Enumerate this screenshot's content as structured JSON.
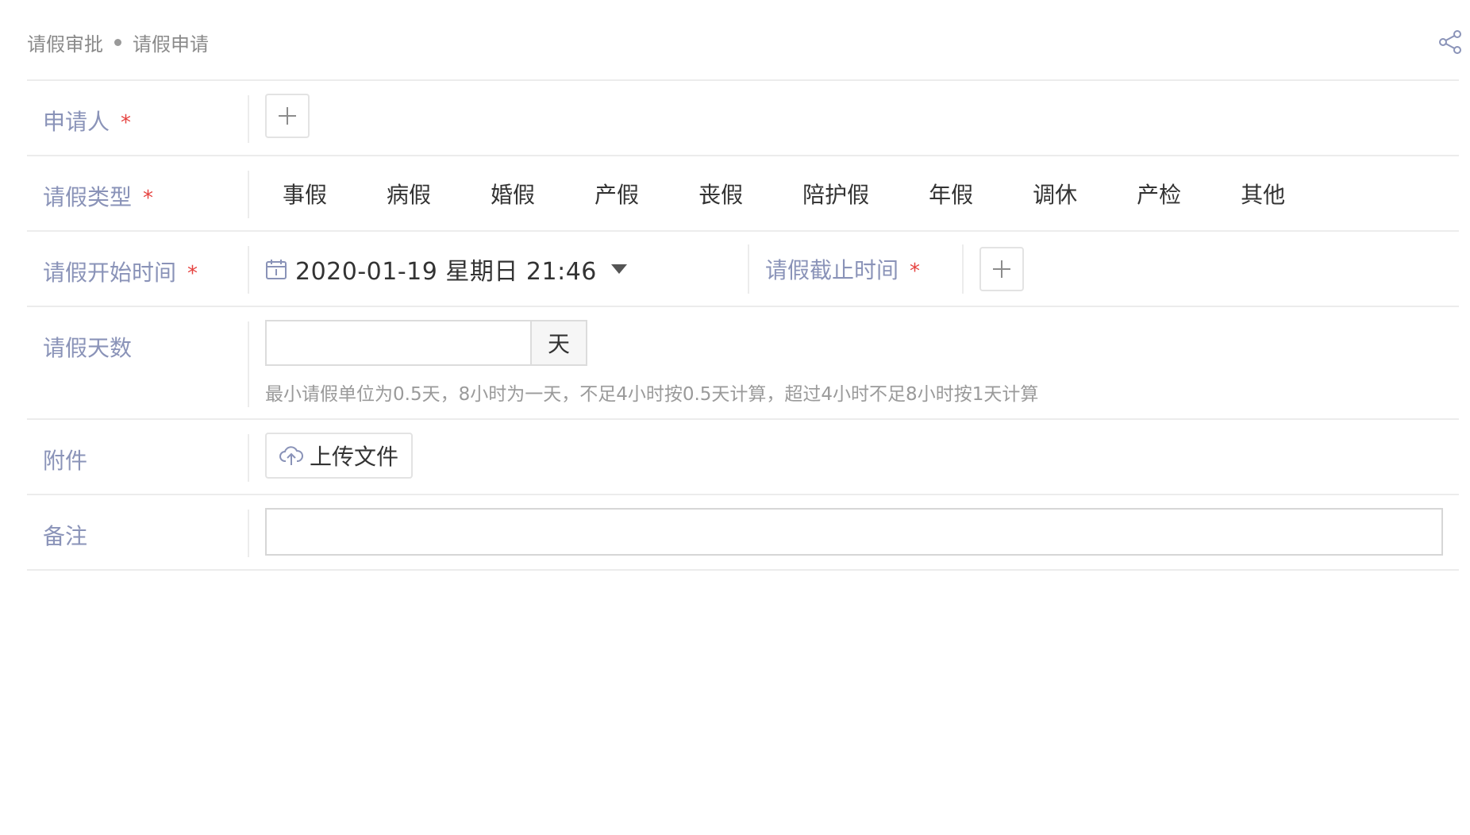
{
  "breadcrumb": {
    "parent": "请假审批",
    "current": "请假申请"
  },
  "icons": {
    "share": "share-icon",
    "add": "plus-icon",
    "calendar": "calendar-icon",
    "upload": "cloud-upload-icon",
    "dropdown": "caret-down-icon"
  },
  "form": {
    "applicant": {
      "label": "申请人",
      "required_mark": "*"
    },
    "leave_type": {
      "label": "请假类型",
      "required_mark": "*",
      "options": [
        "事假",
        "病假",
        "婚假",
        "产假",
        "丧假",
        "陪护假",
        "年假",
        "调休",
        "产检",
        "其他"
      ]
    },
    "start_time": {
      "label": "请假开始时间",
      "required_mark": "*",
      "value": "2020-01-19 星期日 21:46"
    },
    "end_time": {
      "label": "请假截止时间",
      "required_mark": "*"
    },
    "days": {
      "label": "请假天数",
      "value": "",
      "unit": "天",
      "hint": "最小请假单位为0.5天，8小时为一天，不足4小时按0.5天计算，超过4小时不足8小时按1天计算"
    },
    "attachment": {
      "label": "附件",
      "button_label": "上传文件"
    },
    "remark": {
      "label": "备注",
      "value": ""
    }
  },
  "colors": {
    "label": "#8a93b8",
    "required": "#e64340",
    "divider": "#ececec"
  }
}
